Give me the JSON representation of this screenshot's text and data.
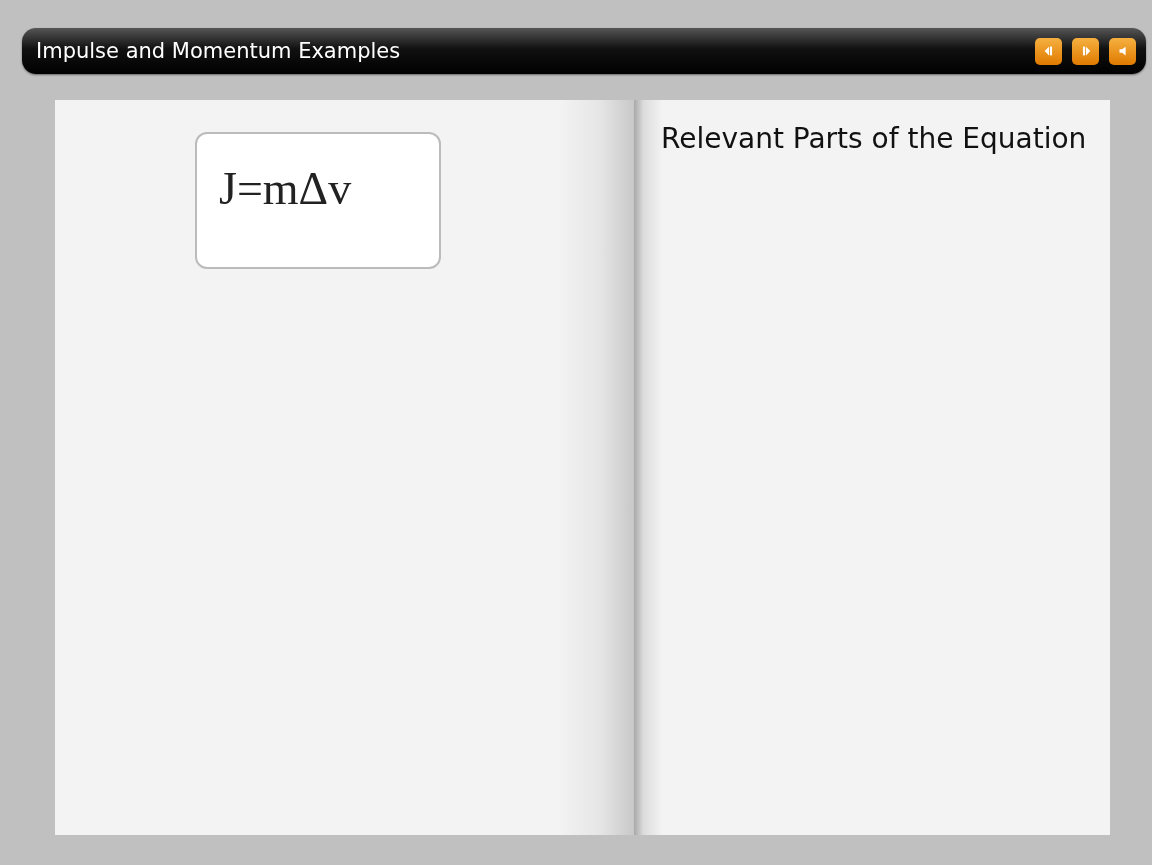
{
  "window": {
    "title": "Impulse and Momentum Examples"
  },
  "toolbar": {
    "buttons": [
      {
        "kind": "previous"
      },
      {
        "kind": "next"
      },
      {
        "kind": "audio"
      }
    ]
  },
  "left_page": {
    "equation": "J=mΔv"
  },
  "right_page": {
    "heading": "Relevant Parts of the Equation"
  }
}
